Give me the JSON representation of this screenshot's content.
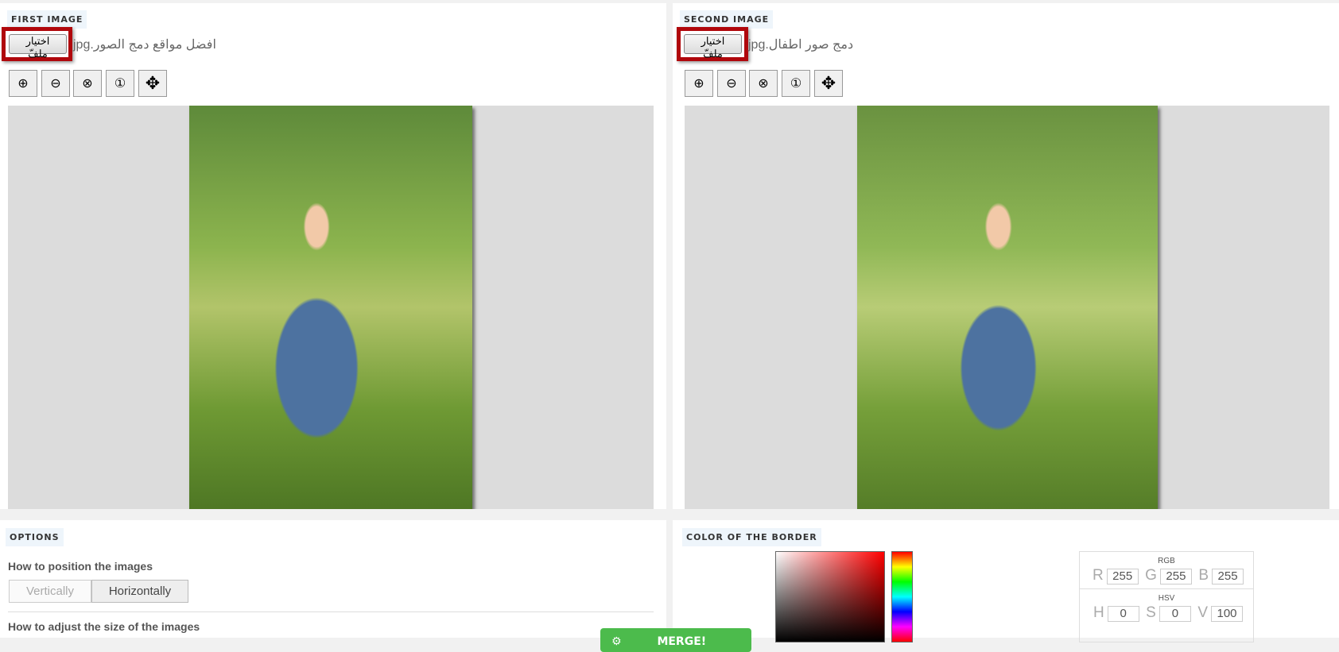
{
  "first_image": {
    "label": "FIRST IMAGE",
    "choose_label": "اختيار ملفّ",
    "filename": "افضل مواقع دمج الصور.jpg"
  },
  "second_image": {
    "label": "SECOND IMAGE",
    "choose_label": "اختيار ملفّ",
    "filename": "دمج صور اطفال.jpg"
  },
  "toolbar": {
    "icons": [
      "zoom-in-icon",
      "zoom-out-icon",
      "zoom-reset-icon",
      "zoom-actual-icon",
      "move-icon"
    ]
  },
  "options": {
    "label": "OPTIONS",
    "position_label": "How to position the images",
    "vertically": "Vertically",
    "horizontally": "Horizontally",
    "selected": "Horizontally",
    "size_label": "How to adjust the size of the images"
  },
  "merge": {
    "label": "MERGE!",
    "color": "#4cbb4c"
  },
  "border": {
    "label": "COLOR OF THE BORDER",
    "rgb_label": "RGB",
    "r": "255",
    "g": "255",
    "b": "255",
    "hsv_label": "HSV",
    "h": "0",
    "s": "0",
    "v": "100",
    "R": "R",
    "G": "G",
    "B": "B",
    "H": "H",
    "S": "S",
    "V": "V"
  },
  "highlight_color": "#b0070c"
}
